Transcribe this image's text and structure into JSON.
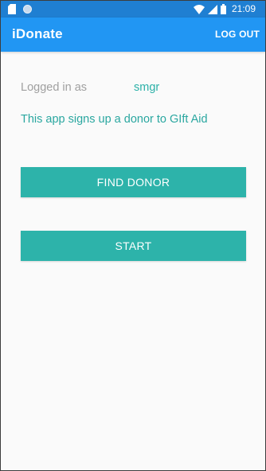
{
  "status_bar": {
    "time": "21:09",
    "icons": [
      "sd-card-icon",
      "circle-notification-icon",
      "wifi-icon",
      "signal-icon",
      "battery-icon"
    ]
  },
  "app_bar": {
    "title": "iDonate",
    "logout_label": "LOG OUT"
  },
  "main": {
    "logged_in_label": "Logged in as",
    "username": "smgr",
    "info_text": "This app signs up a donor to GIft Aid",
    "find_donor_label": "FIND DONOR",
    "start_label": "START"
  },
  "colors": {
    "status_bar": "#1f7fd2",
    "app_bar": "#2196f3",
    "accent": "#2db3aa",
    "label_gray": "#a0a0a0",
    "background": "#fafafa"
  }
}
